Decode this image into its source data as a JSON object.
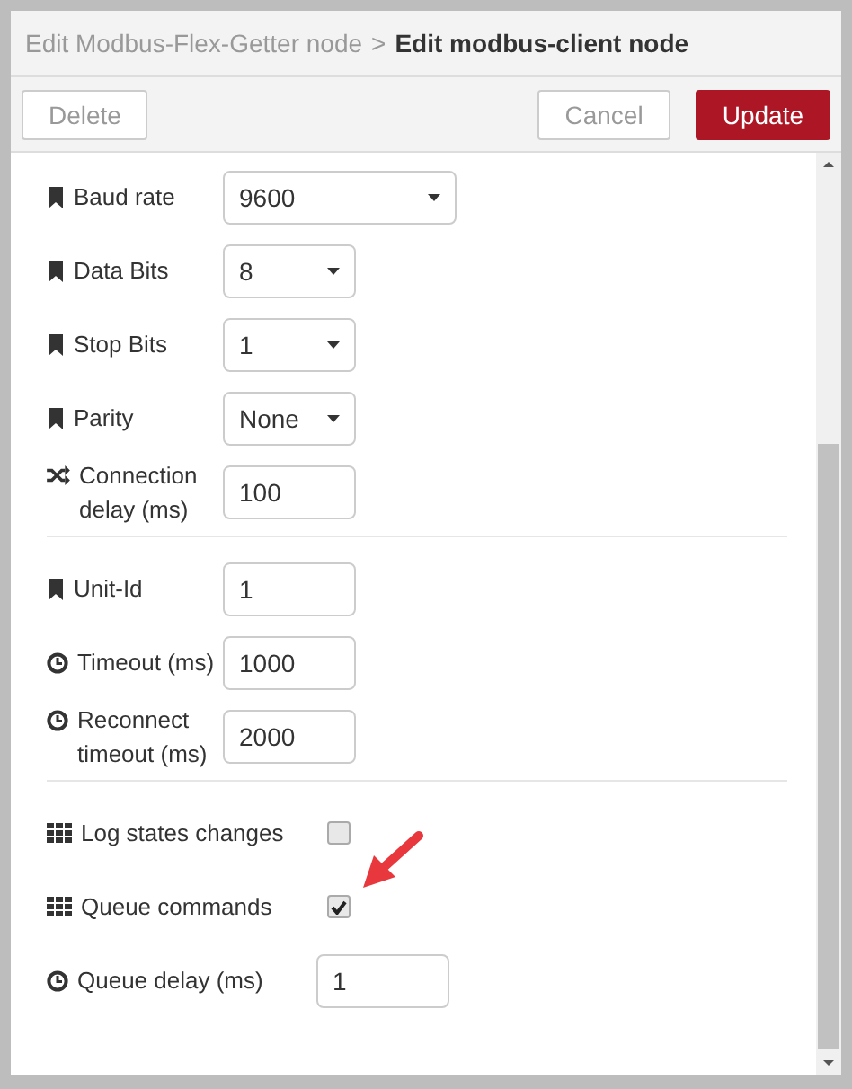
{
  "breadcrumb": {
    "parent": "Edit Modbus-Flex-Getter node",
    "separator": ">",
    "current": "Edit modbus-client node"
  },
  "toolbar": {
    "delete": "Delete",
    "cancel": "Cancel",
    "update": "Update"
  },
  "sections": [
    {
      "rows": [
        {
          "kind": "select",
          "label": "Baud rate",
          "value": "9600"
        },
        {
          "kind": "select",
          "label": "Data Bits",
          "value": "8"
        },
        {
          "kind": "select",
          "label": "Stop Bits",
          "value": "1"
        },
        {
          "kind": "select",
          "label": "Parity",
          "value": "None"
        },
        {
          "kind": "input",
          "label": "Connection delay (ms)",
          "value": "100"
        }
      ]
    },
    {
      "rows": [
        {
          "kind": "input",
          "label": "Unit-Id",
          "value": "1"
        },
        {
          "kind": "input",
          "label": "Timeout (ms)",
          "value": "1000"
        },
        {
          "kind": "input",
          "label": "Reconnect timeout (ms)",
          "value": "2000"
        }
      ]
    },
    {
      "rows": [
        {
          "kind": "checkbox",
          "label": "Log states changes",
          "checked": false
        },
        {
          "kind": "checkbox",
          "label": "Queue commands",
          "checked": true
        },
        {
          "kind": "input",
          "label": "Queue delay (ms)",
          "value": "1"
        }
      ]
    }
  ]
}
